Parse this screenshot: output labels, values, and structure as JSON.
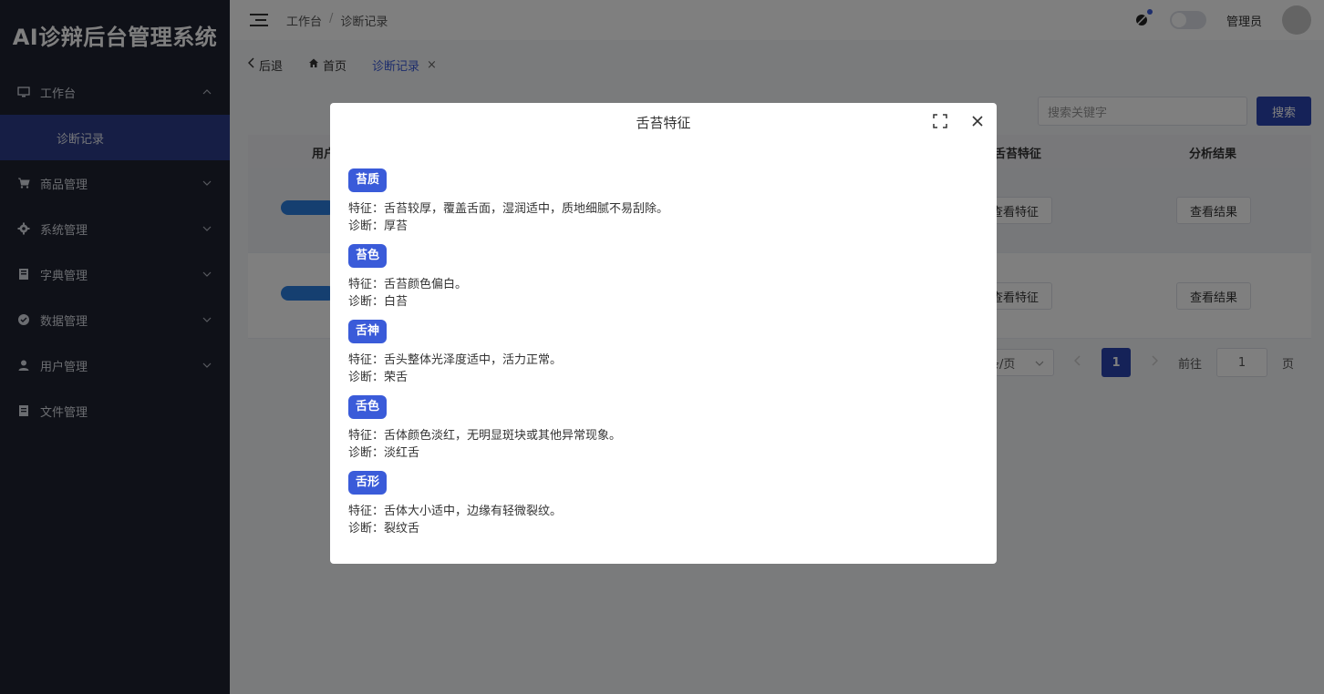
{
  "app": {
    "brand": "AI诊辩后台管理系统"
  },
  "sidebar": {
    "items": [
      {
        "label": "工作台",
        "icon": "monitor-icon",
        "expanded": true
      },
      {
        "label": "商品管理",
        "icon": "cart-icon"
      },
      {
        "label": "系统管理",
        "icon": "gear-icon"
      },
      {
        "label": "字典管理",
        "icon": "dictionary-icon"
      },
      {
        "label": "数据管理",
        "icon": "check-circle-icon"
      },
      {
        "label": "用户管理",
        "icon": "user-icon"
      },
      {
        "label": "文件管理",
        "icon": "file-icon"
      }
    ],
    "active_subitem": "诊断记录"
  },
  "header": {
    "breadcrumb": [
      "工作台",
      "诊断记录"
    ],
    "breadcrumb_sep": "/",
    "admin_name": "管理员"
  },
  "tabs": {
    "back_label": "后退",
    "home_label": "首页",
    "active_label": "诊断记录",
    "close_glyph": "×"
  },
  "toolbar": {
    "search_placeholder": "搜索关键字",
    "search_button": "搜索"
  },
  "table": {
    "columns": {
      "user": "用户",
      "feature": "舌苔特征",
      "result": "分析结果"
    },
    "rows": [
      {
        "feature_btn": "查看特征",
        "result_btn": "查看结果"
      },
      {
        "feature_btn": "查看特征",
        "result_btn": "查看结果"
      }
    ]
  },
  "pagination": {
    "page_size_label": "条/页",
    "current_page": "1",
    "goto_label": "前往",
    "goto_value": "1",
    "page_suffix": "页"
  },
  "dialog": {
    "title": "舌苔特征",
    "sections": [
      {
        "tag": "苔质",
        "feature": "特征：舌苔较厚，覆盖舌面，湿润适中，质地细腻不易刮除。",
        "diagnosis": "诊断：厚苔"
      },
      {
        "tag": "苔色",
        "feature": "特征：舌苔颜色偏白。",
        "diagnosis": "诊断：白苔"
      },
      {
        "tag": "舌神",
        "feature": "特征：舌头整体光泽度适中，活力正常。",
        "diagnosis": "诊断：荣舌"
      },
      {
        "tag": "舌色",
        "feature": "特征：舌体颜色淡红，无明显斑块或其他异常现象。",
        "diagnosis": "诊断：淡红舌"
      },
      {
        "tag": "舌形",
        "feature": "特征：舌体大小适中，边缘有轻微裂纹。",
        "diagnosis": "诊断：裂纹舌"
      }
    ]
  },
  "colors": {
    "sidebar_bg": "#1f2230",
    "accent": "#3a5bd9",
    "primary_button": "#2a44b0"
  }
}
